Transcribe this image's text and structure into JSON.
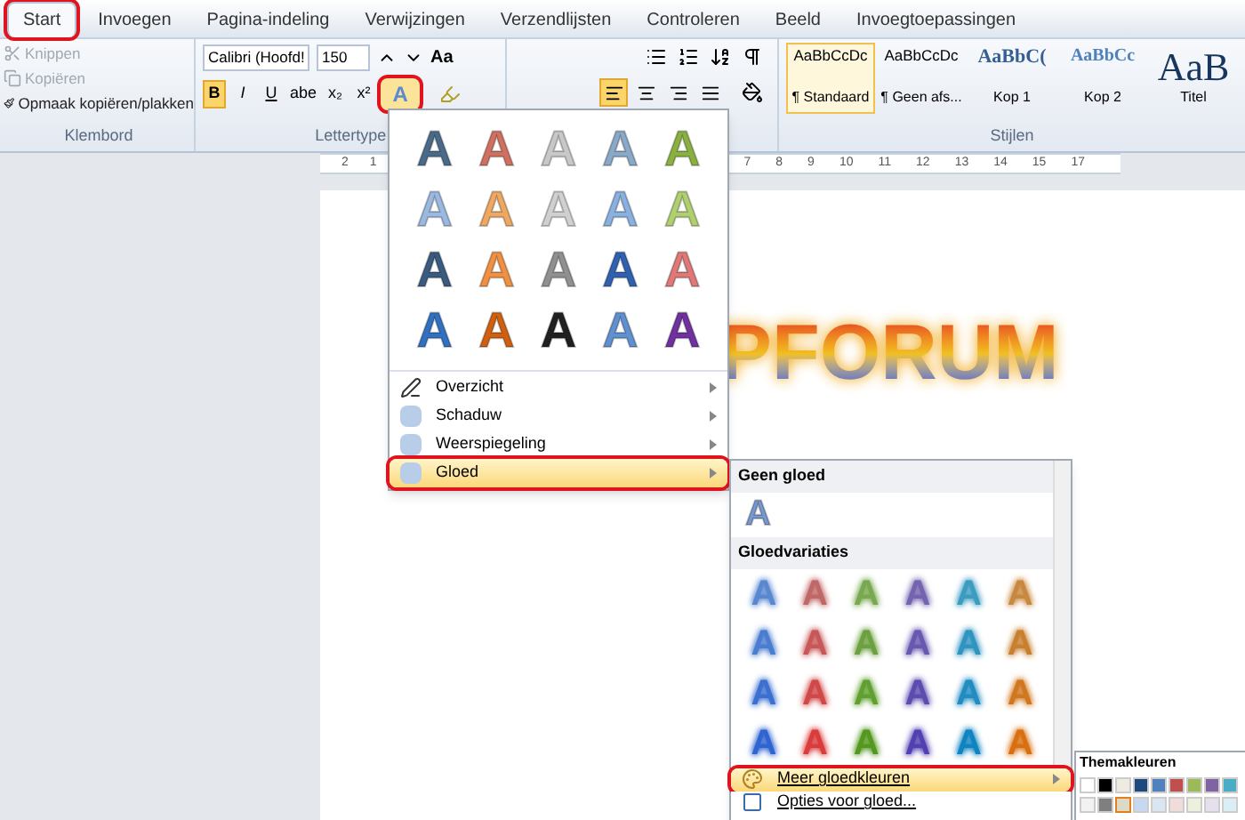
{
  "tabs": [
    {
      "label": "Start",
      "selected": true,
      "circled": true
    },
    {
      "label": "Invoegen",
      "selected": false,
      "circled": false
    },
    {
      "label": "Pagina-indeling",
      "selected": false,
      "circled": false
    },
    {
      "label": "Verwijzingen",
      "selected": false,
      "circled": false
    },
    {
      "label": "Verzendlijsten",
      "selected": false,
      "circled": false
    },
    {
      "label": "Controleren",
      "selected": false,
      "circled": false
    },
    {
      "label": "Beeld",
      "selected": false,
      "circled": false
    },
    {
      "label": "Invoegtoepassingen",
      "selected": false,
      "circled": false
    }
  ],
  "clipboard": {
    "items": [
      {
        "label": "Knippen",
        "disabled": true
      },
      {
        "label": "Kopiëren",
        "disabled": true
      },
      {
        "label": "Opmaak kopiëren/plakken",
        "disabled": false
      }
    ],
    "group_label": "Klembord"
  },
  "font": {
    "family": "Calibri (Hoofd!",
    "size": "150",
    "case_label": "Aa",
    "group_label": "Lettertype",
    "style_buttons": [
      {
        "label": "B",
        "selected": true
      },
      {
        "label": "I",
        "selected": false
      },
      {
        "label": "U",
        "selected": false
      },
      {
        "label": "abe",
        "selected": false
      },
      {
        "label": "x₂",
        "selected": false
      },
      {
        "label": "x²",
        "selected": false
      }
    ],
    "text_effects_button": {
      "glyph": "A",
      "circled": true
    }
  },
  "paragraph": {
    "align": [
      {
        "selected": true
      },
      {
        "selected": false
      },
      {
        "selected": false
      },
      {
        "selected": false
      }
    ]
  },
  "styles": {
    "group_label": "Stijlen",
    "items": [
      {
        "sample": "AaBbCcDc",
        "name": "¶ Standaard",
        "selected": true,
        "kind": "body"
      },
      {
        "sample": "AaBbCcDc",
        "name": "¶ Geen afs...",
        "selected": false,
        "kind": "body"
      },
      {
        "sample": "AaBbC(",
        "name": "Kop 1",
        "selected": false,
        "kind": "heading1"
      },
      {
        "sample": "AaBbCc",
        "name": "Kop 2",
        "selected": false,
        "kind": "heading2"
      },
      {
        "sample": "AaB",
        "name": "Titel",
        "selected": false,
        "kind": "title"
      }
    ]
  },
  "ruler": {
    "left_labels": [
      "2",
      "1"
    ],
    "right_labels": [
      "7",
      "8",
      "9",
      "10",
      "11",
      "12",
      "13",
      "14",
      "15",
      "17"
    ]
  },
  "document": {
    "text": "PFORUM"
  },
  "text_effects_menu": {
    "gallery": [
      [
        {
          "glyph": "A",
          "color": "#4a6a8a"
        },
        {
          "glyph": "A",
          "color": "#d07060"
        },
        {
          "glyph": "A",
          "color": "#c8c8c8"
        },
        {
          "glyph": "A",
          "color": "#8aa8c8"
        },
        {
          "glyph": "A",
          "color": "#8ab040"
        }
      ],
      [
        {
          "glyph": "A",
          "color": "#9ab8e0"
        },
        {
          "glyph": "A",
          "color": "#f0a860"
        },
        {
          "glyph": "A",
          "color": "#d0d0d0"
        },
        {
          "glyph": "A",
          "color": "#88b0e0"
        },
        {
          "glyph": "A",
          "color": "#b0d070"
        }
      ],
      [
        {
          "glyph": "A",
          "color": "#3a5a80"
        },
        {
          "glyph": "A",
          "color": "#f09040"
        },
        {
          "glyph": "A",
          "color": "#909090"
        },
        {
          "glyph": "A",
          "color": "#3060b0"
        },
        {
          "glyph": "A",
          "color": "#e07878"
        }
      ],
      [
        {
          "glyph": "A",
          "color": "#3070c0"
        },
        {
          "glyph": "A",
          "color": "#d06010"
        },
        {
          "glyph": "A",
          "color": "#202020"
        },
        {
          "glyph": "A",
          "color": "#6090d0"
        },
        {
          "glyph": "A",
          "color": "#7030a0"
        }
      ]
    ],
    "items": [
      {
        "label": "Overzicht",
        "highlighted": false,
        "circled": false,
        "kind": "outline"
      },
      {
        "label": "Schaduw",
        "highlighted": false,
        "circled": false,
        "kind": "shadow"
      },
      {
        "label": "Weerspiegeling",
        "highlighted": false,
        "circled": false,
        "kind": "reflection"
      },
      {
        "label": "Gloed",
        "highlighted": true,
        "circled": true,
        "kind": "glow"
      }
    ]
  },
  "glow_menu": {
    "none_header": "Geen gloed",
    "none_glyph": "A",
    "variations_header": "Gloedvariaties",
    "variations": [
      [
        {
          "glyph": "A",
          "color": "#5a88d0"
        },
        {
          "glyph": "A",
          "color": "#c06868"
        },
        {
          "glyph": "A",
          "color": "#78a850"
        },
        {
          "glyph": "A",
          "color": "#7464b0"
        },
        {
          "glyph": "A",
          "color": "#3c9cc0"
        },
        {
          "glyph": "A",
          "color": "#c88840"
        }
      ],
      [
        {
          "glyph": "A",
          "color": "#4a7cd0"
        },
        {
          "glyph": "A",
          "color": "#c85858"
        },
        {
          "glyph": "A",
          "color": "#6ca040"
        },
        {
          "glyph": "A",
          "color": "#6858b0"
        },
        {
          "glyph": "A",
          "color": "#3094c0"
        },
        {
          "glyph": "A",
          "color": "#c88030"
        }
      ],
      [
        {
          "glyph": "A",
          "color": "#3c70d0"
        },
        {
          "glyph": "A",
          "color": "#d04848"
        },
        {
          "glyph": "A",
          "color": "#60a030"
        },
        {
          "glyph": "A",
          "color": "#5c4cb0"
        },
        {
          "glyph": "A",
          "color": "#208cc0"
        },
        {
          "glyph": "A",
          "color": "#d07820"
        }
      ],
      [
        {
          "glyph": "A",
          "color": "#3064d0"
        },
        {
          "glyph": "A",
          "color": "#d83c3c"
        },
        {
          "glyph": "A",
          "color": "#549820"
        },
        {
          "glyph": "A",
          "color": "#5040b0"
        },
        {
          "glyph": "A",
          "color": "#1084c0"
        },
        {
          "glyph": "A",
          "color": "#d87010"
        }
      ]
    ],
    "items": [
      {
        "label": "Meer gloedkleuren",
        "highlighted": true,
        "circled": true,
        "kind": "colors"
      },
      {
        "label": "Opties voor gloed...",
        "highlighted": false,
        "circled": false,
        "kind": "options"
      }
    ]
  },
  "palette": {
    "header": "Themakleuren",
    "rows": [
      [
        {
          "color": "#ffffff",
          "selected": false
        },
        {
          "color": "#000000",
          "selected": false
        },
        {
          "color": "#eeece1",
          "selected": false
        },
        {
          "color": "#1f497d",
          "selected": false
        },
        {
          "color": "#4f81bd",
          "selected": false
        },
        {
          "color": "#c0504d",
          "selected": false
        },
        {
          "color": "#9bbb59",
          "selected": false
        },
        {
          "color": "#8064a2",
          "selected": false
        },
        {
          "color": "#4bacc6",
          "selected": false
        }
      ],
      [
        {
          "color": "#f2f2f2",
          "selected": false
        },
        {
          "color": "#7f7f7f",
          "selected": false
        },
        {
          "color": "#ddd9c3",
          "selected": true
        },
        {
          "color": "#c6d9f0",
          "selected": false
        },
        {
          "color": "#dbe5f1",
          "selected": false
        },
        {
          "color": "#f2dcdb",
          "selected": false
        },
        {
          "color": "#ebf1dd",
          "selected": false
        },
        {
          "color": "#e5e0ec",
          "selected": false
        },
        {
          "color": "#dbeef3",
          "selected": false
        }
      ]
    ]
  }
}
